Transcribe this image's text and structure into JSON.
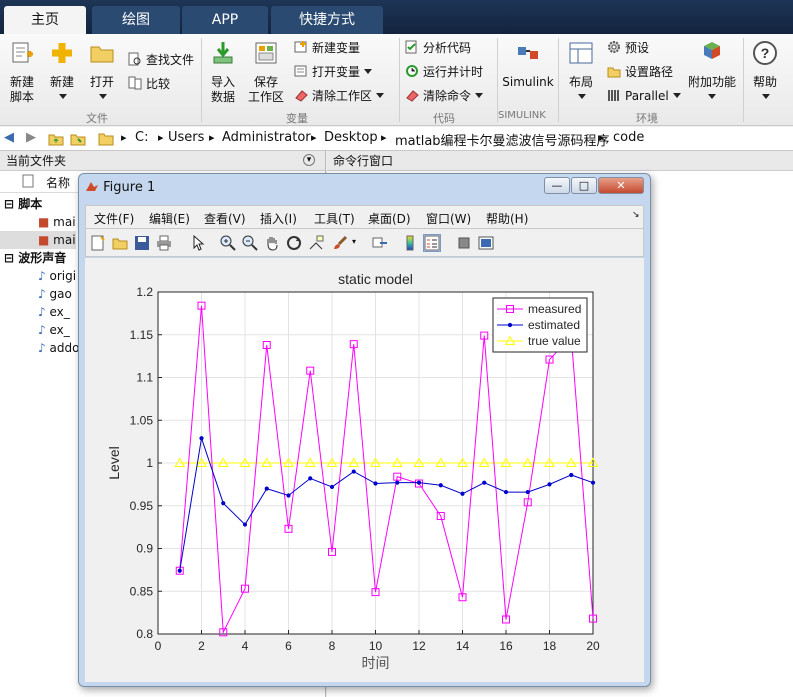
{
  "tabs": [
    "主页",
    "绘图",
    "APP",
    "快捷方式"
  ],
  "ribbon": {
    "file_group": "文件",
    "var_group": "变量",
    "code_group": "代码",
    "simulink_group": "SIMULINK",
    "env_group": "环境",
    "new_script": [
      "新建",
      "脚本"
    ],
    "new": "新建",
    "open": "打开",
    "find_files": "查找文件",
    "compare": "比较",
    "import": [
      "导入",
      "数据"
    ],
    "save_ws": [
      "保存",
      "工作区"
    ],
    "new_var": "新建变量",
    "open_var": "打开变量",
    "clear_ws": "清除工作区",
    "analyze_code": "分析代码",
    "run_time": "运行并计时",
    "clear_cmd": "清除命令",
    "simulink": "Simulink",
    "layout": "布局",
    "prefs": "预设",
    "set_path": "设置路径",
    "parallel": "Parallel",
    "addons": "附加功能",
    "help": "帮助"
  },
  "address": [
    "C:",
    "Users",
    "Administrator",
    "Desktop",
    "matlab编程卡尔曼滤波信号源码程序",
    "code"
  ],
  "left_pane": {
    "title": "当前文件夹",
    "col_name": "名称",
    "group1": "脚本",
    "group2": "波形声音",
    "scripts": [
      "mai",
      "mai"
    ],
    "sounds": [
      "origi",
      "gao",
      "ex_",
      "ex_",
      "addo"
    ]
  },
  "right_pane": {
    "title": "命令行窗口"
  },
  "figure": {
    "title": "Figure 1",
    "menu": [
      "文件(F)",
      "编辑(E)",
      "查看(V)",
      "插入(I)",
      "工具(T)",
      "桌面(D)",
      "窗口(W)",
      "帮助(H)"
    ]
  },
  "colors": {
    "measured": "#ff00ff",
    "estimated": "#0000cc",
    "true_value": "#ffff00"
  },
  "chart_data": {
    "type": "line",
    "title": "static model",
    "xlabel": "时间",
    "ylabel": "Level",
    "xlim": [
      0,
      20
    ],
    "ylim": [
      0.8,
      1.2
    ],
    "xticks": [
      0,
      2,
      4,
      6,
      8,
      10,
      12,
      14,
      16,
      18,
      20
    ],
    "yticks": [
      0.8,
      0.85,
      0.9,
      0.95,
      1,
      1.05,
      1.1,
      1.15,
      1.2
    ],
    "ytick_labels": [
      "0.8",
      "0.85",
      "0.9",
      "0.95",
      "1",
      "1.05",
      "1.1",
      "1.15",
      "1.2"
    ],
    "grid": true,
    "legend": "top-right",
    "x": [
      1,
      2,
      3,
      4,
      5,
      6,
      7,
      8,
      9,
      10,
      11,
      12,
      13,
      14,
      15,
      16,
      17,
      18,
      19,
      20
    ],
    "series": [
      {
        "name": "measured",
        "marker": "square",
        "values": [
          0.874,
          1.184,
          0.802,
          0.853,
          1.138,
          0.923,
          1.108,
          0.896,
          1.139,
          0.849,
          0.984,
          0.976,
          0.938,
          0.843,
          1.149,
          0.817,
          0.954,
          1.121,
          1.148,
          0.818
        ]
      },
      {
        "name": "estimated",
        "marker": "dot",
        "values": [
          0.874,
          1.029,
          0.953,
          0.928,
          0.97,
          0.962,
          0.982,
          0.972,
          0.99,
          0.976,
          0.977,
          0.977,
          0.974,
          0.964,
          0.977,
          0.966,
          0.966,
          0.975,
          0.986,
          0.977
        ]
      },
      {
        "name": "true value",
        "marker": "triangle",
        "values": [
          1,
          1,
          1,
          1,
          1,
          1,
          1,
          1,
          1,
          1,
          1,
          1,
          1,
          1,
          1,
          1,
          1,
          1,
          1,
          1
        ]
      }
    ]
  }
}
